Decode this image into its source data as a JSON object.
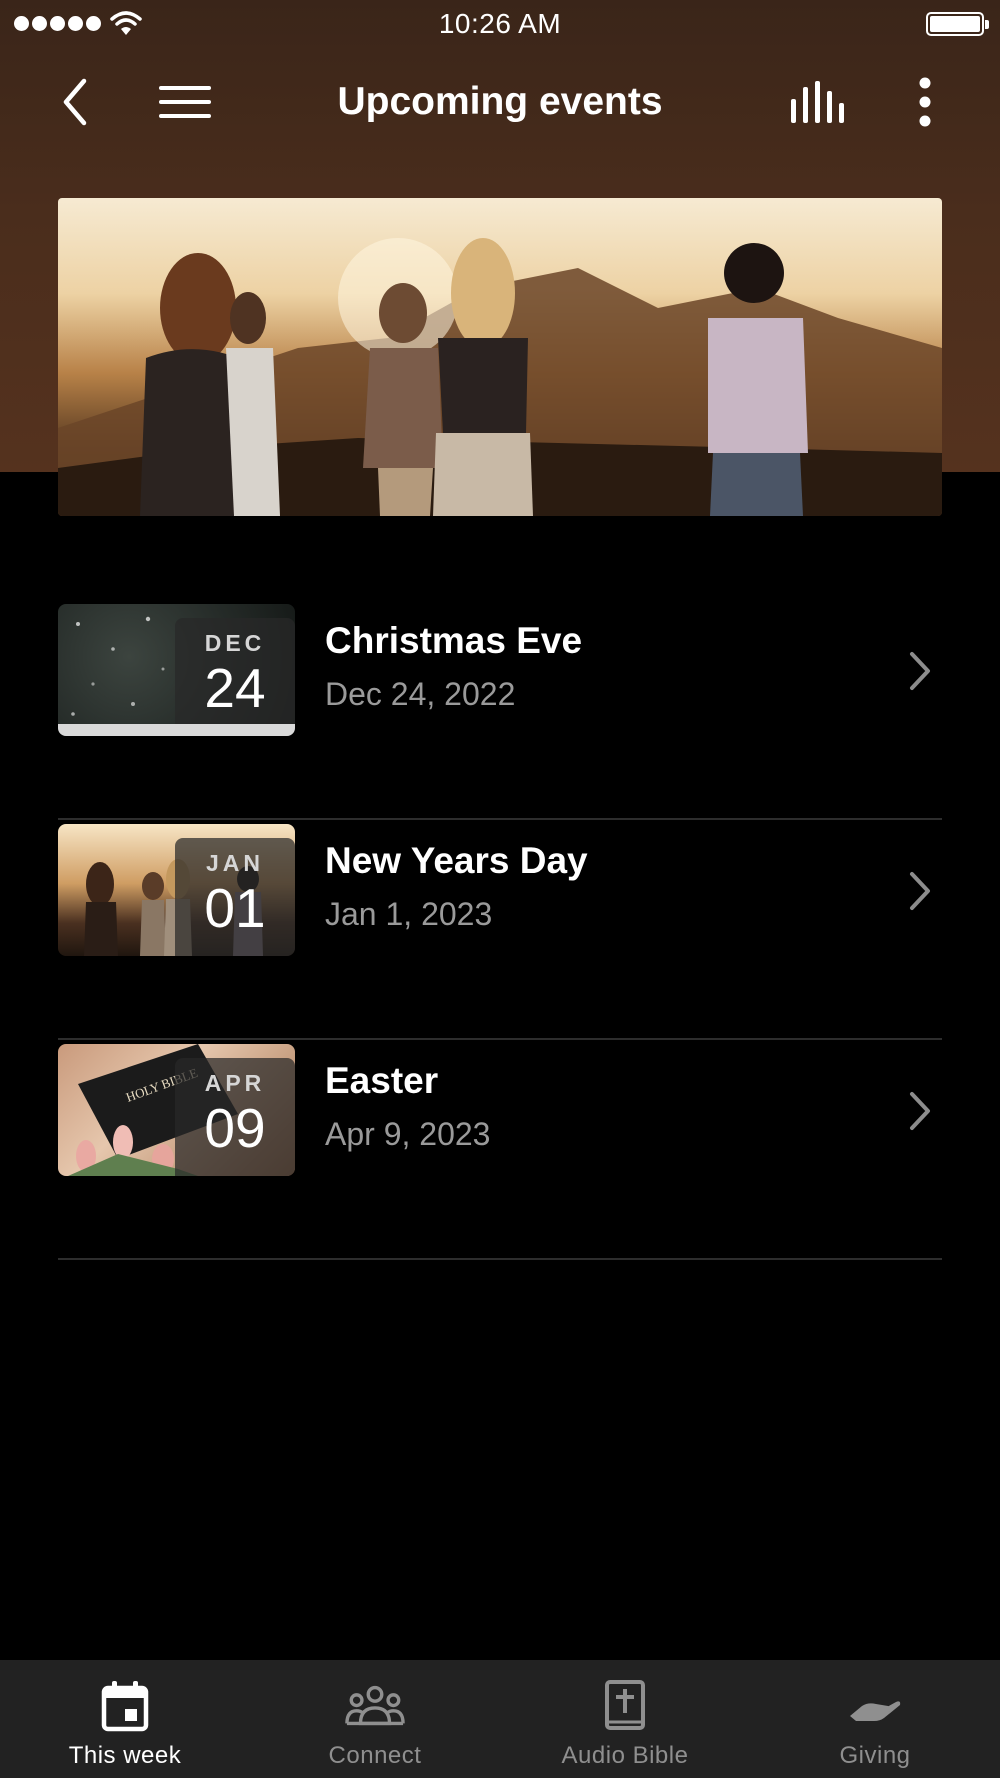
{
  "status_bar": {
    "time": "10:26 AM",
    "signal_icon": "signal-dots-icon",
    "wifi_icon": "wifi-icon",
    "battery_icon": "battery-full-icon"
  },
  "nav": {
    "title": "Upcoming events",
    "back_icon": "chevron-left-icon",
    "menu_icon": "hamburger-menu-icon",
    "stats_icon": "audio-bars-icon",
    "more_icon": "more-vertical-icon"
  },
  "hero": {
    "image": "group-of-friends-at-sunset-photo"
  },
  "events": [
    {
      "month": "DEC",
      "day": "24",
      "title": "Christmas Eve",
      "date": "Dec 24, 2022",
      "thumbnail": "snowy-night-photo"
    },
    {
      "month": "JAN",
      "day": "01",
      "title": "New Years Day",
      "date": "Jan 1, 2023",
      "thumbnail": "friends-at-sunset-photo"
    },
    {
      "month": "APR",
      "day": "09",
      "title": "Easter",
      "date": "Apr 9, 2023",
      "thumbnail": "holy-bible-with-tulips-photo"
    }
  ],
  "thumbnail_text": {
    "bible_cover": "HOLY BIBLE"
  },
  "tabs": [
    {
      "label": "This week",
      "icon": "calendar-icon",
      "active": true
    },
    {
      "label": "Connect",
      "icon": "people-group-icon",
      "active": false
    },
    {
      "label": "Audio Bible",
      "icon": "bible-book-icon",
      "active": false
    },
    {
      "label": "Giving",
      "icon": "giving-hand-icon",
      "active": false
    }
  ],
  "colors": {
    "header_gradient_top": "#3a2519",
    "header_gradient_bottom": "#55321e",
    "background": "#000000",
    "tab_bar": "#222222",
    "secondary_text": "#9a9a9a",
    "inactive_tab": "#8f8f8f"
  }
}
